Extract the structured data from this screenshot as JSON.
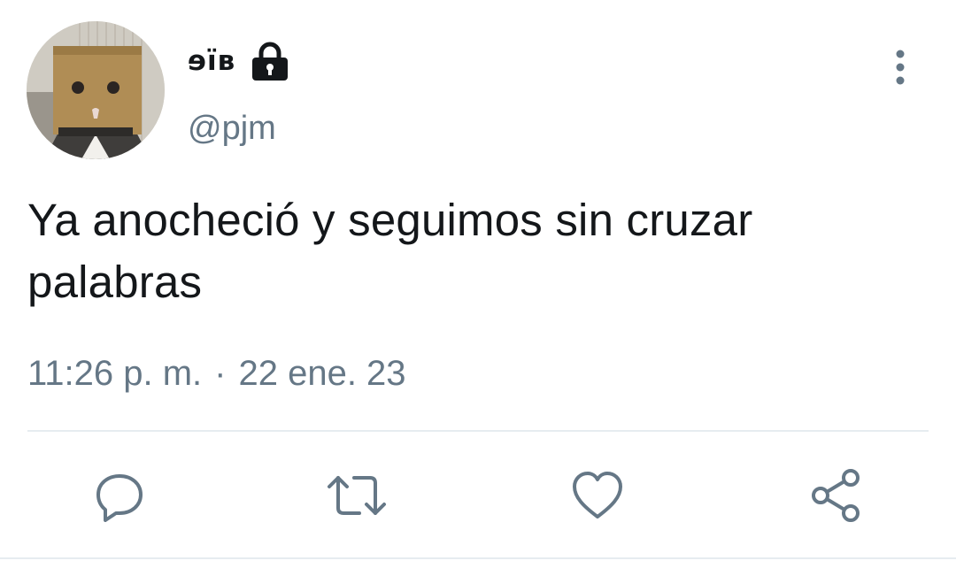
{
  "tweet": {
    "display_name": "ɘïʙ",
    "handle": "@pjm",
    "text_line1": "Ya anocheció y seguimos sin cruzar",
    "text_line2": "palabras",
    "time": "11:26 p. m.",
    "separator": "·",
    "date": "22 ene. 23",
    "protected": true
  },
  "icons": {
    "lock": "lock-icon",
    "more": "more-vertical-icon",
    "reply": "reply-icon",
    "retweet": "retweet-icon",
    "like": "heart-icon",
    "share": "share-icon"
  },
  "colors": {
    "text": "#14171a",
    "secondary": "#657786",
    "divider": "#e6ecf0"
  }
}
